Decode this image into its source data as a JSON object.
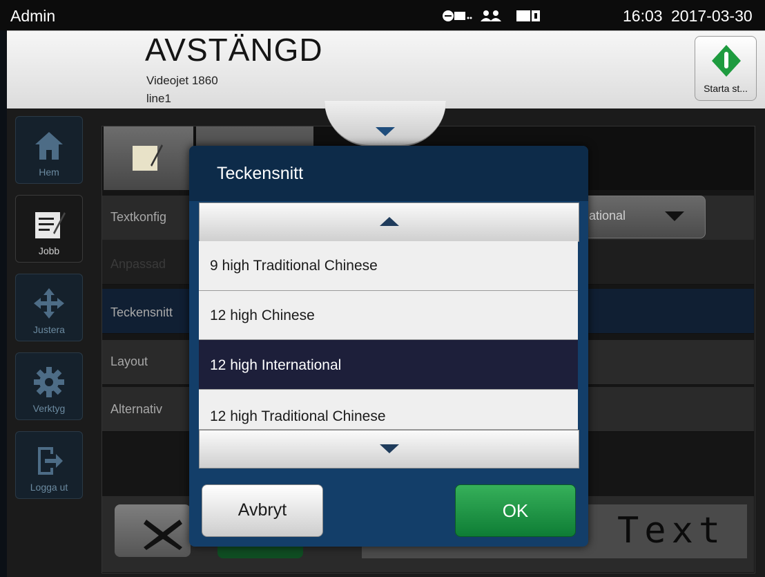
{
  "topbar": {
    "user": "Admin",
    "time": "16:03",
    "date": "2017-03-30"
  },
  "header": {
    "state": "AVSTÄNGD",
    "model": "Videojet 1860",
    "line": "line1",
    "start_label": "Starta st..."
  },
  "nav": {
    "items": [
      {
        "label": "Hem",
        "icon": "home-icon"
      },
      {
        "label": "Jobb",
        "icon": "job-edit-icon"
      },
      {
        "label": "Justera",
        "icon": "move-arrows-icon"
      },
      {
        "label": "Verktyg",
        "icon": "gear-icon"
      },
      {
        "label": "Logga ut",
        "icon": "logout-icon"
      }
    ]
  },
  "background": {
    "rows": [
      "Textkonfig",
      "Anpassad",
      "Teckensnitt",
      "Layout",
      "Alternativ"
    ],
    "dropdown_value": "ational",
    "preview_text": "Text"
  },
  "dialog": {
    "title": "Teckensnitt",
    "options": [
      "9 high Traditional Chinese",
      "12 high Chinese",
      "12 high International",
      "12 high Traditional Chinese"
    ],
    "selected": "12 high International",
    "cancel_label": "Avbryt",
    "ok_label": "OK"
  },
  "colors": {
    "ok_green": "#1a9a45",
    "dialog_blue": "#133e69",
    "selected_row": "#1d1f3a"
  }
}
